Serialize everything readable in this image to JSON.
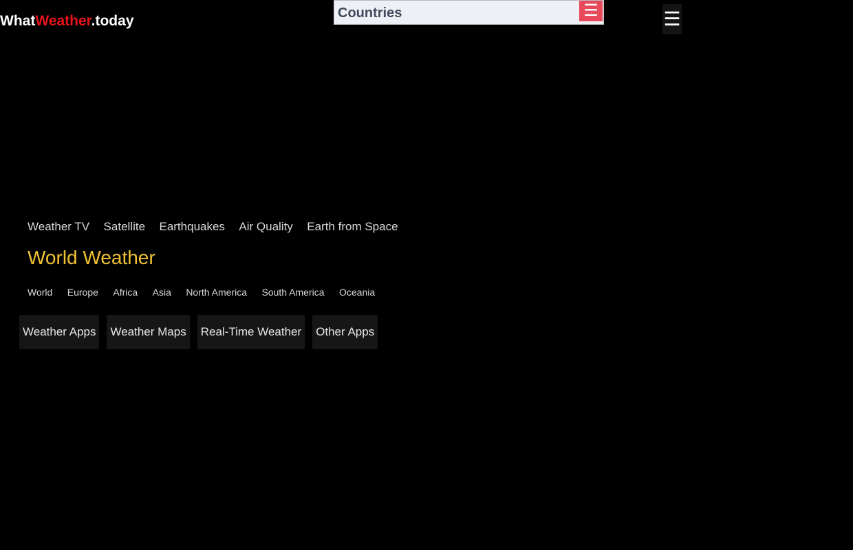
{
  "header": {
    "logo": {
      "part1": "What",
      "part2": "Weather",
      "part3": ".today"
    },
    "countries_select": {
      "label": "Countries",
      "menu_icon": "hamburger-icon",
      "accent": "#e84a5c"
    },
    "main_menu": {
      "icon": "hamburger-icon",
      "glyph": "☰"
    }
  },
  "tools_nav": [
    {
      "label": "Weather TV"
    },
    {
      "label": "Satellite"
    },
    {
      "label": "Earthquakes"
    },
    {
      "label": "Air Quality"
    },
    {
      "label": "Earth from Space"
    }
  ],
  "section_title": "World Weather",
  "regions_nav": [
    {
      "label": "World"
    },
    {
      "label": "Europe"
    },
    {
      "label": "Africa"
    },
    {
      "label": "Asia"
    },
    {
      "label": "North America"
    },
    {
      "label": "South America"
    },
    {
      "label": "Oceania"
    }
  ],
  "apps": [
    {
      "label": "Weather Apps"
    },
    {
      "label": "Weather Maps"
    },
    {
      "label": "Real-Time Weather"
    },
    {
      "label": "Other Apps"
    }
  ]
}
